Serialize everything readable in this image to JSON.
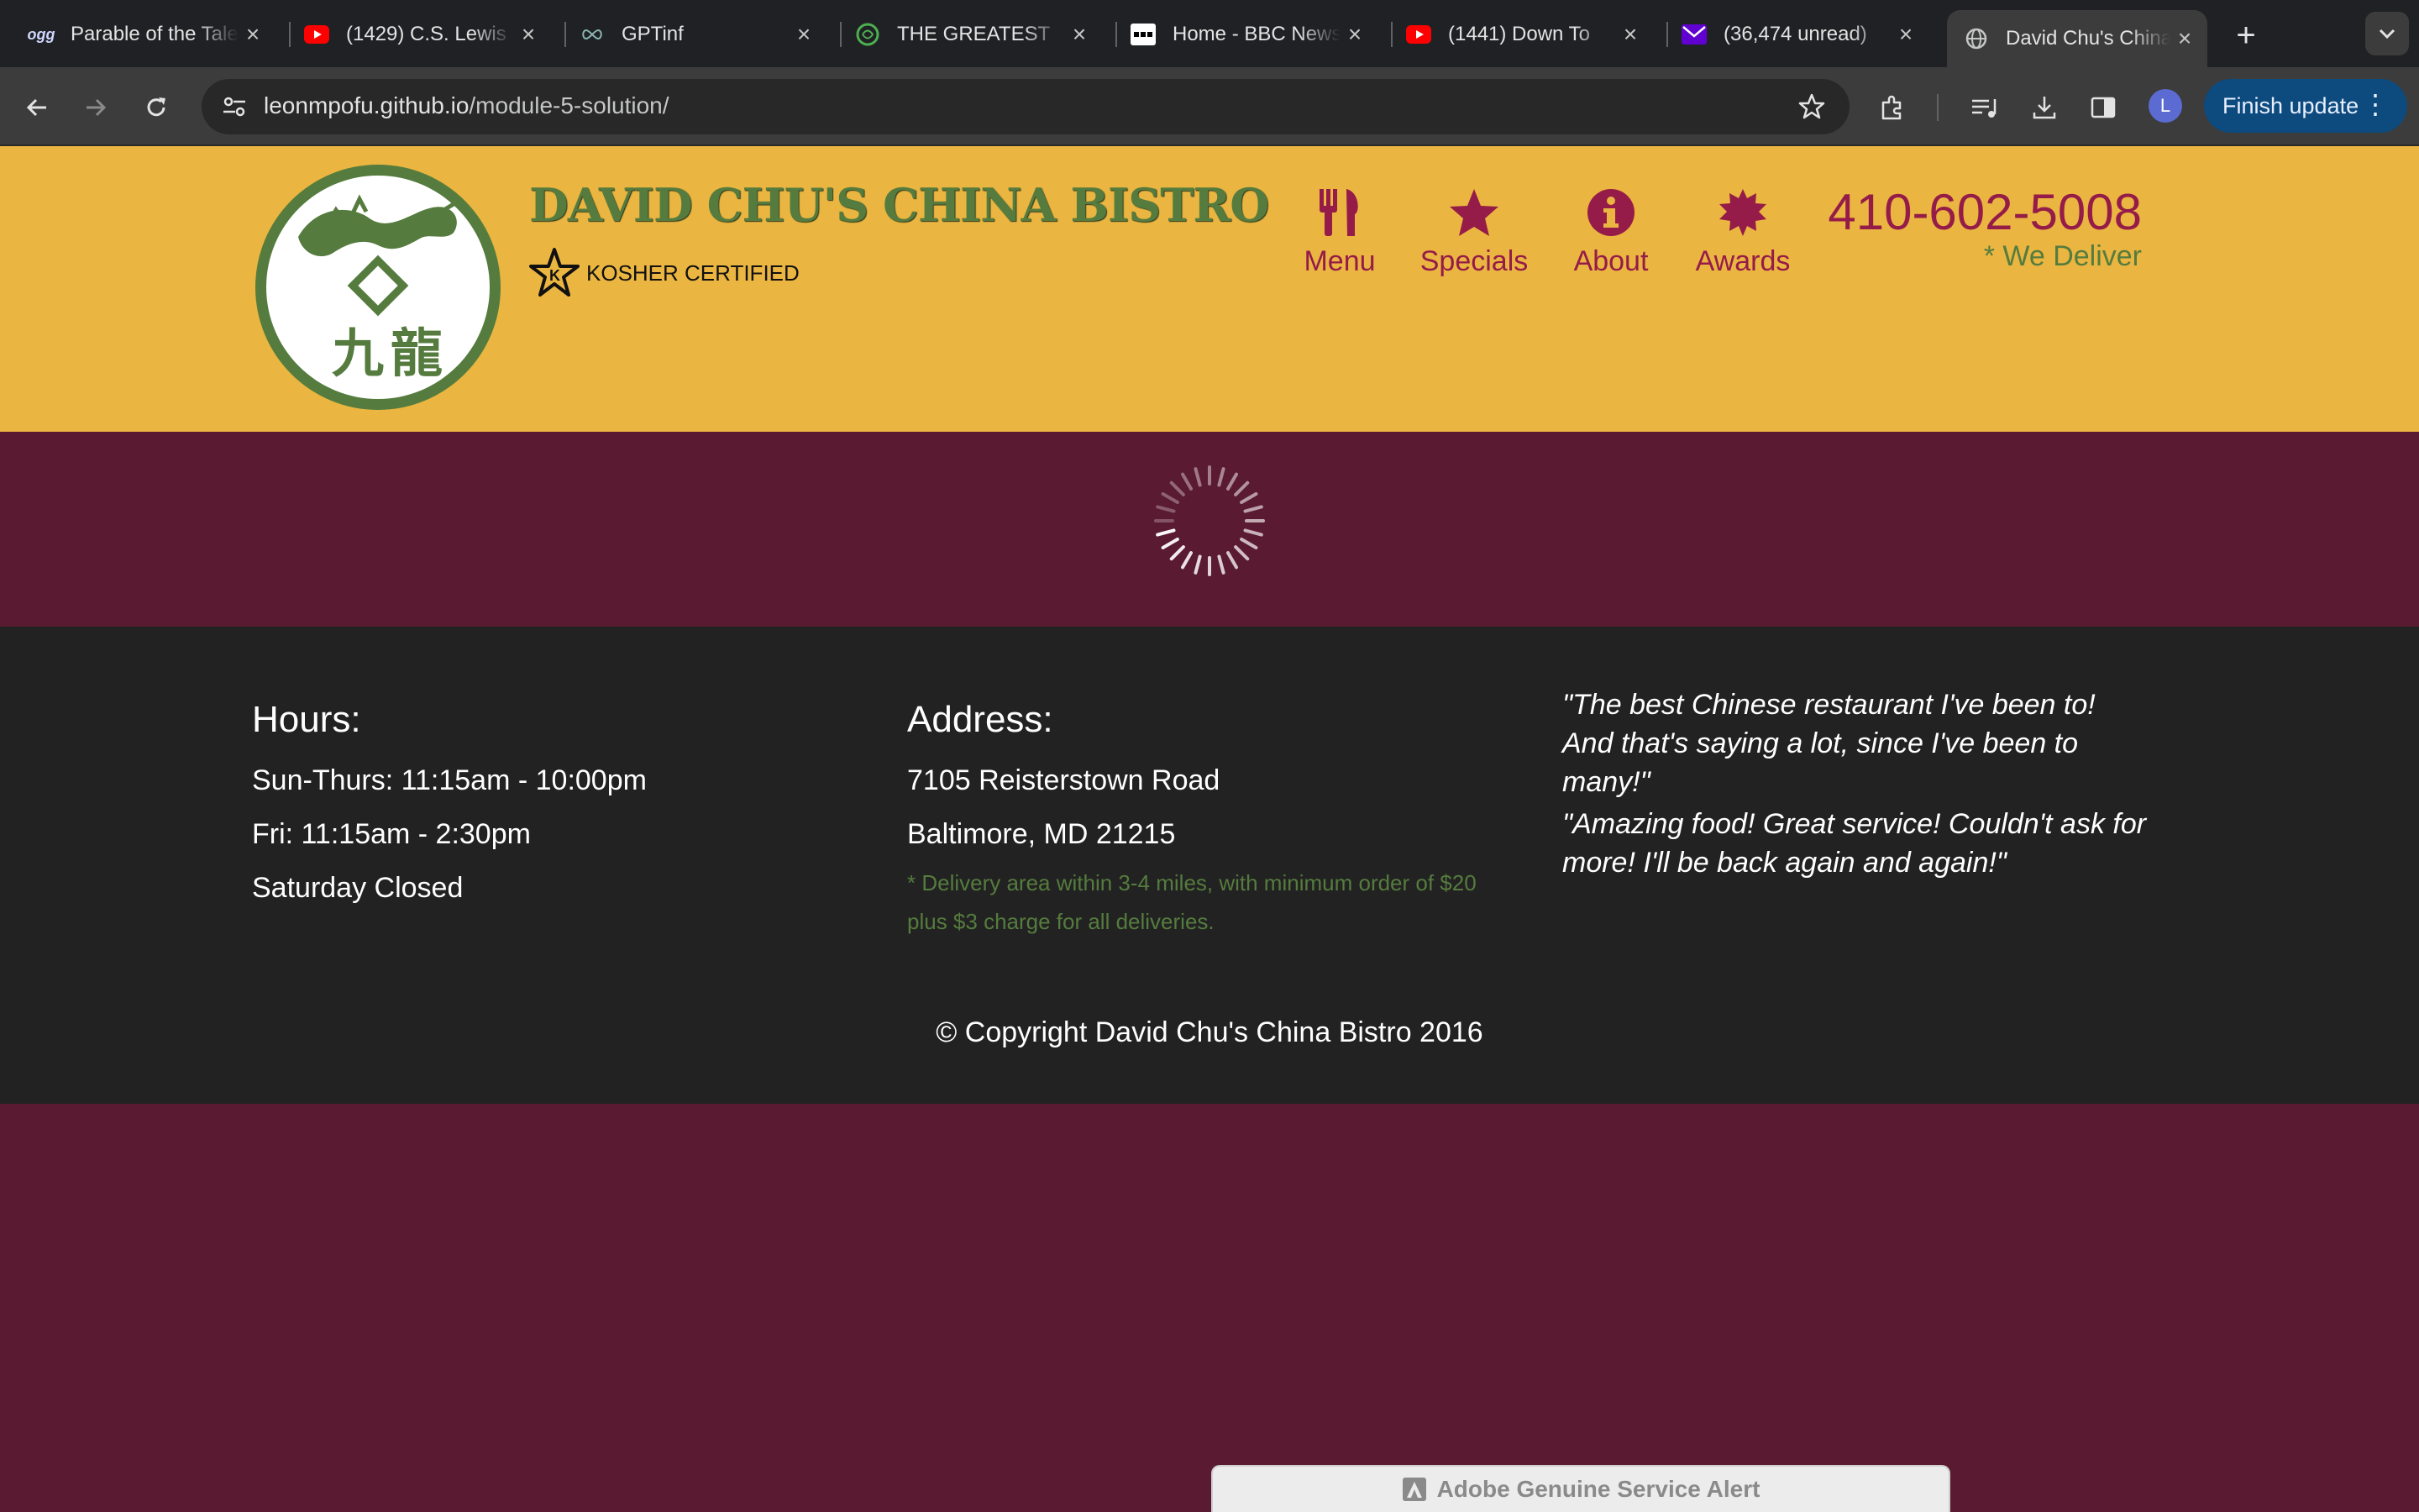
{
  "browser": {
    "tabs": [
      {
        "title": "Parable of the Talents",
        "icon": "ogg-icon"
      },
      {
        "title": "(1429) C.S. Lewis",
        "icon": "youtube-icon"
      },
      {
        "title": "GPTinf",
        "icon": "infinity-icon"
      },
      {
        "title": "THE GREATEST",
        "icon": "brain-icon"
      },
      {
        "title": "Home - BBC News",
        "icon": "bbc-icon"
      },
      {
        "title": "(1441) Down To",
        "icon": "youtube-icon"
      },
      {
        "title": "(36,474 unread)",
        "icon": "yahoo-mail-icon"
      },
      {
        "title": "David Chu's China Bistro",
        "icon": "globe-icon",
        "active": true
      }
    ],
    "url_host": "leonmpofu.github.io",
    "url_path": "/module-5-solution/",
    "avatar_letter": "L",
    "finish_update_label": "Finish update"
  },
  "site": {
    "brand": "DAVID CHU'S CHINA BISTRO",
    "kosher": "KOSHER CERTIFIED",
    "nav": [
      {
        "label": "Menu",
        "icon": "utensils-icon"
      },
      {
        "label": "Specials",
        "icon": "star-icon"
      },
      {
        "label": "About",
        "icon": "info-icon"
      },
      {
        "label": "Awards",
        "icon": "certificate-icon"
      }
    ],
    "phone": "410-602-5008",
    "deliver": "* We Deliver",
    "colors": {
      "header_bg": "#eab540",
      "maroon": "#5a1a31",
      "accent": "#951c49",
      "green": "#557c3e",
      "footer_bg": "#222222"
    }
  },
  "footer": {
    "hours": {
      "title": "Hours:",
      "lines": [
        "Sun-Thurs: 11:15am - 10:00pm",
        "Fri: 11:15am - 2:30pm",
        "Saturday Closed"
      ]
    },
    "address": {
      "title": "Address:",
      "lines": [
        "7105 Reisterstown Road",
        "Baltimore, MD 21215"
      ],
      "note": "* Delivery area within 3-4 miles, with minimum order of $20 plus $3 charge for all deliveries."
    },
    "quotes": [
      "\"The best Chinese restaurant I've been to! And that's saying a lot, since I've been to many!\"",
      "\"Amazing food! Great service! Couldn't ask for more! I'll be back again and again!\""
    ],
    "copyright": "© Copyright David Chu's China Bistro 2016"
  },
  "toast": {
    "text": "Adobe Genuine Service Alert"
  }
}
